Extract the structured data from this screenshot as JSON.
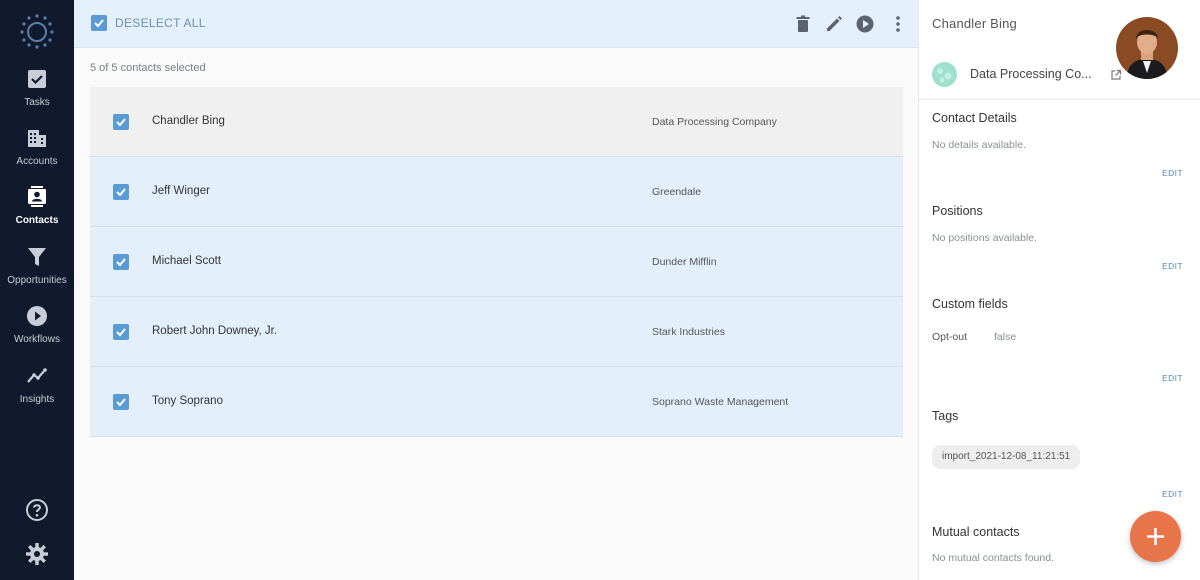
{
  "sidebar": {
    "items": [
      {
        "label": "Tasks",
        "icon": "checkbox-icon"
      },
      {
        "label": "Accounts",
        "icon": "building-icon"
      },
      {
        "label": "Contacts",
        "icon": "contact-card-icon"
      },
      {
        "label": "Opportunities",
        "icon": "funnel-icon"
      },
      {
        "label": "Workflows",
        "icon": "play-circle-icon"
      },
      {
        "label": "Insights",
        "icon": "trend-line-icon"
      }
    ],
    "active": "Contacts"
  },
  "toolbar": {
    "deselect_label": "DESELECT ALL",
    "selection_count": "5 of 5 contacts selected"
  },
  "contacts": [
    {
      "name": "Chandler Bing",
      "company": "Data Processing Company"
    },
    {
      "name": "Jeff Winger",
      "company": "Greendale"
    },
    {
      "name": "Michael Scott",
      "company": "Dunder Mifflin"
    },
    {
      "name": "Robert John Downey, Jr.",
      "company": "Stark Industries"
    },
    {
      "name": "Tony Soprano",
      "company": "Soprano Waste Management"
    }
  ],
  "detail": {
    "name": "Chandler Bing",
    "company": "Data Processing Co...",
    "contact_details": {
      "title": "Contact Details",
      "text": "No details available."
    },
    "positions": {
      "title": "Positions",
      "text": "No positions available."
    },
    "custom_fields": {
      "title": "Custom fields",
      "field_label": "Opt-out",
      "field_value": "false"
    },
    "tags": {
      "title": "Tags",
      "items": [
        "import_2021-12-08_11:21:51"
      ]
    },
    "mutual_contacts": {
      "title": "Mutual contacts",
      "text": "No mutual contacts found."
    },
    "edit_label": "EDIT"
  },
  "colors": {
    "sidebar_bg": "#101a2c",
    "selected_row": "#e3f0fb",
    "checkbox": "#5b9bd5",
    "fab": "#e8744a",
    "link": "#5a84b6"
  }
}
